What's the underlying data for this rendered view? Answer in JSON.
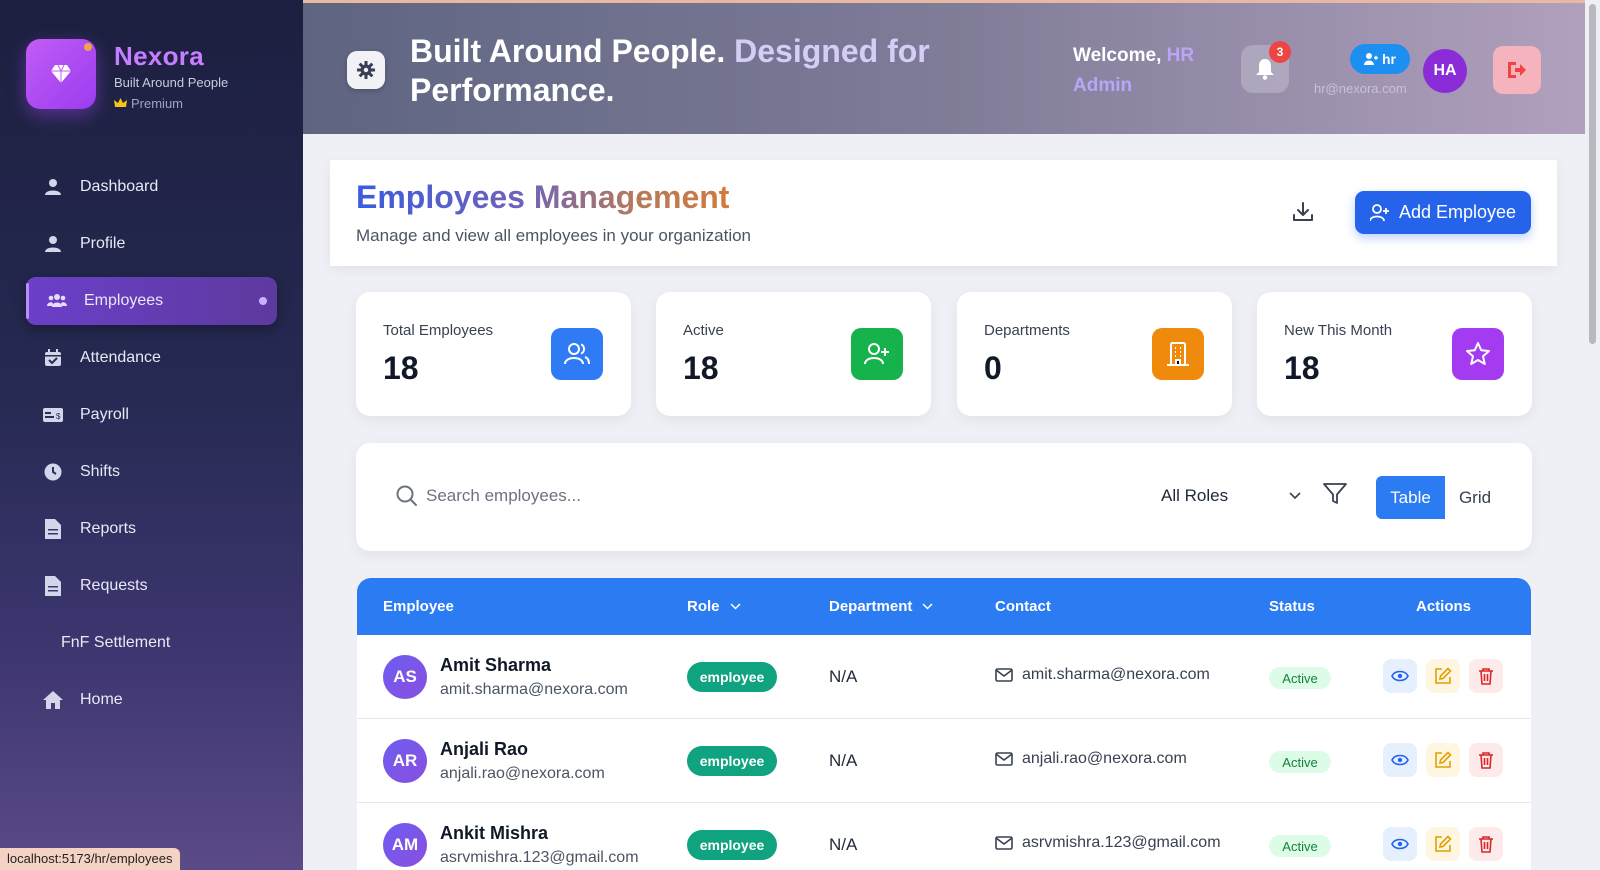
{
  "brand": {
    "name": "Nexora",
    "tagline": "Built Around People",
    "tier": "Premium"
  },
  "sidebar": {
    "items": [
      {
        "label": "Dashboard",
        "icon": "user-icon"
      },
      {
        "label": "Profile",
        "icon": "user-icon"
      },
      {
        "label": "Employees",
        "icon": "users-icon",
        "active": true
      },
      {
        "label": "Attendance",
        "icon": "calendar-check-icon"
      },
      {
        "label": "Payroll",
        "icon": "money-card-icon"
      },
      {
        "label": "Shifts",
        "icon": "clock-icon"
      },
      {
        "label": "Reports",
        "icon": "document-icon"
      },
      {
        "label": "Requests",
        "icon": "document-icon"
      },
      {
        "label": "FnF Settlement",
        "icon": ""
      },
      {
        "label": "Home",
        "icon": "home-icon"
      }
    ]
  },
  "header": {
    "headline_part1": "Built Around People.",
    "headline_part2": "Designed for",
    "headline_part3": "Performance.",
    "welcome_prefix": "Welcome,",
    "welcome_name": "HR Admin",
    "notification_count": "3",
    "role": "hr",
    "email": "hr@nexora.com",
    "avatar_initials": "HA"
  },
  "page": {
    "title_part1": "Employees",
    "title_part2": "Management",
    "subtitle": "Manage and view all employees in your organization",
    "add_button": "Add Employee"
  },
  "stats": [
    {
      "label": "Total Employees",
      "value": "18",
      "icon": "users-icon",
      "color": "#2f7bf5"
    },
    {
      "label": "Active",
      "value": "18",
      "icon": "user-plus-icon",
      "color": "#16b24b"
    },
    {
      "label": "Departments",
      "value": "0",
      "icon": "building-icon",
      "color": "#f08a0c"
    },
    {
      "label": "New This Month",
      "value": "18",
      "icon": "star-icon",
      "color": "#a53bf0"
    }
  ],
  "filters": {
    "search_placeholder": "Search employees...",
    "role_select": "All Roles",
    "view_table": "Table",
    "view_grid": "Grid"
  },
  "table": {
    "headers": {
      "employee": "Employee",
      "role": "Role",
      "department": "Department",
      "contact": "Contact",
      "status": "Status",
      "actions": "Actions"
    },
    "rows": [
      {
        "initials": "AS",
        "name": "Amit Sharma",
        "email": "amit.sharma@nexora.com",
        "role": "employee",
        "department": "N/A",
        "contact": "amit.sharma@nexora.com",
        "status": "Active"
      },
      {
        "initials": "AR",
        "name": "Anjali Rao",
        "email": "anjali.rao@nexora.com",
        "role": "employee",
        "department": "N/A",
        "contact": "anjali.rao@nexora.com",
        "status": "Active"
      },
      {
        "initials": "AM",
        "name": "Ankit Mishra",
        "email": "asrvmishra.123@gmail.com",
        "role": "employee",
        "department": "N/A",
        "contact": "asrvmishra.123@gmail.com",
        "status": "Active"
      }
    ]
  },
  "status_bar": {
    "url": "localhost:5173/hr/employees"
  },
  "colors": {
    "accent": "#2b7bf3",
    "brand": "#c77dff",
    "success": "#10a37f"
  }
}
